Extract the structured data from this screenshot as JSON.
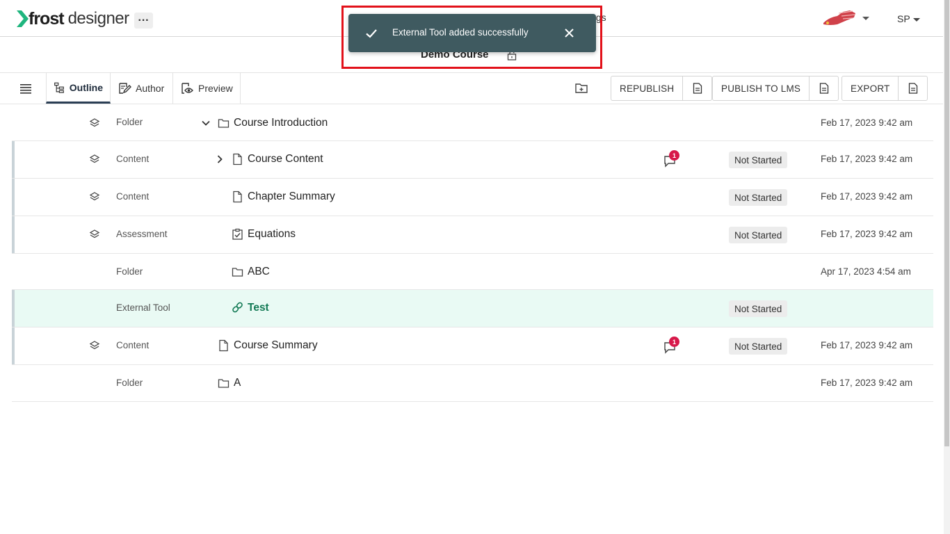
{
  "app": {
    "logo_text_bold": "frost",
    "logo_text_light": "designer",
    "more_label": "···",
    "settings_peek": "ings",
    "user_initials": "SP"
  },
  "course": {
    "title": "Demo Course"
  },
  "toolbar": {
    "tabs": [
      {
        "label": "Outline",
        "icon": "outline-tree-icon",
        "active": true
      },
      {
        "label": "Author",
        "icon": "author-edit-icon",
        "active": false
      },
      {
        "label": "Preview",
        "icon": "preview-eye-icon",
        "active": false
      }
    ],
    "republish_label": "REPUBLISH",
    "publish_lms_label": "PUBLISH TO LMS",
    "export_label": "EXPORT"
  },
  "rows": [
    {
      "type": "Folder",
      "name": "Course Introduction",
      "icon": "folder-icon",
      "expander": "chevron-down-icon",
      "status": "",
      "date": "Feb 17, 2023 9:42 am",
      "comments": ""
    },
    {
      "type": "Content",
      "name": "Course Content",
      "icon": "document-icon",
      "expander": "chevron-right-icon",
      "status": "Not Started",
      "date": "Feb 17, 2023 9:42 am",
      "comments": "1"
    },
    {
      "type": "Content",
      "name": "Chapter Summary",
      "icon": "document-icon",
      "expander": "",
      "status": "Not Started",
      "date": "Feb 17, 2023 9:42 am",
      "comments": ""
    },
    {
      "type": "Assessment",
      "name": "Equations",
      "icon": "checkbox-clipboard-icon",
      "expander": "",
      "status": "Not Started",
      "date": "Feb 17, 2023 9:42 am",
      "comments": ""
    },
    {
      "type": "Folder",
      "name": "ABC",
      "icon": "folder-icon",
      "expander": "",
      "status": "",
      "date": "Apr 17, 2023 4:54 am",
      "comments": ""
    },
    {
      "type": "External Tool",
      "name": "Test",
      "icon": "link-icon",
      "expander": "",
      "status": "Not Started",
      "date": "",
      "comments": ""
    },
    {
      "type": "Content",
      "name": "Course Summary",
      "icon": "document-icon",
      "expander": "",
      "status": "Not Started",
      "date": "Feb 17, 2023 9:42 am",
      "comments": "1"
    },
    {
      "type": "Folder",
      "name": "A",
      "icon": "folder-icon",
      "expander": "",
      "status": "",
      "date": "Feb 17, 2023 9:42 am",
      "comments": ""
    }
  ],
  "toast": {
    "message": "External Tool added successfully"
  },
  "colors": {
    "toast_bg": "#3f5a60",
    "highlight_row": "#e9faf4",
    "highlight_text": "#137a55",
    "badge": "#d7194a",
    "annotation_box": "#e2111a",
    "logo_green": "#1fb57e"
  }
}
